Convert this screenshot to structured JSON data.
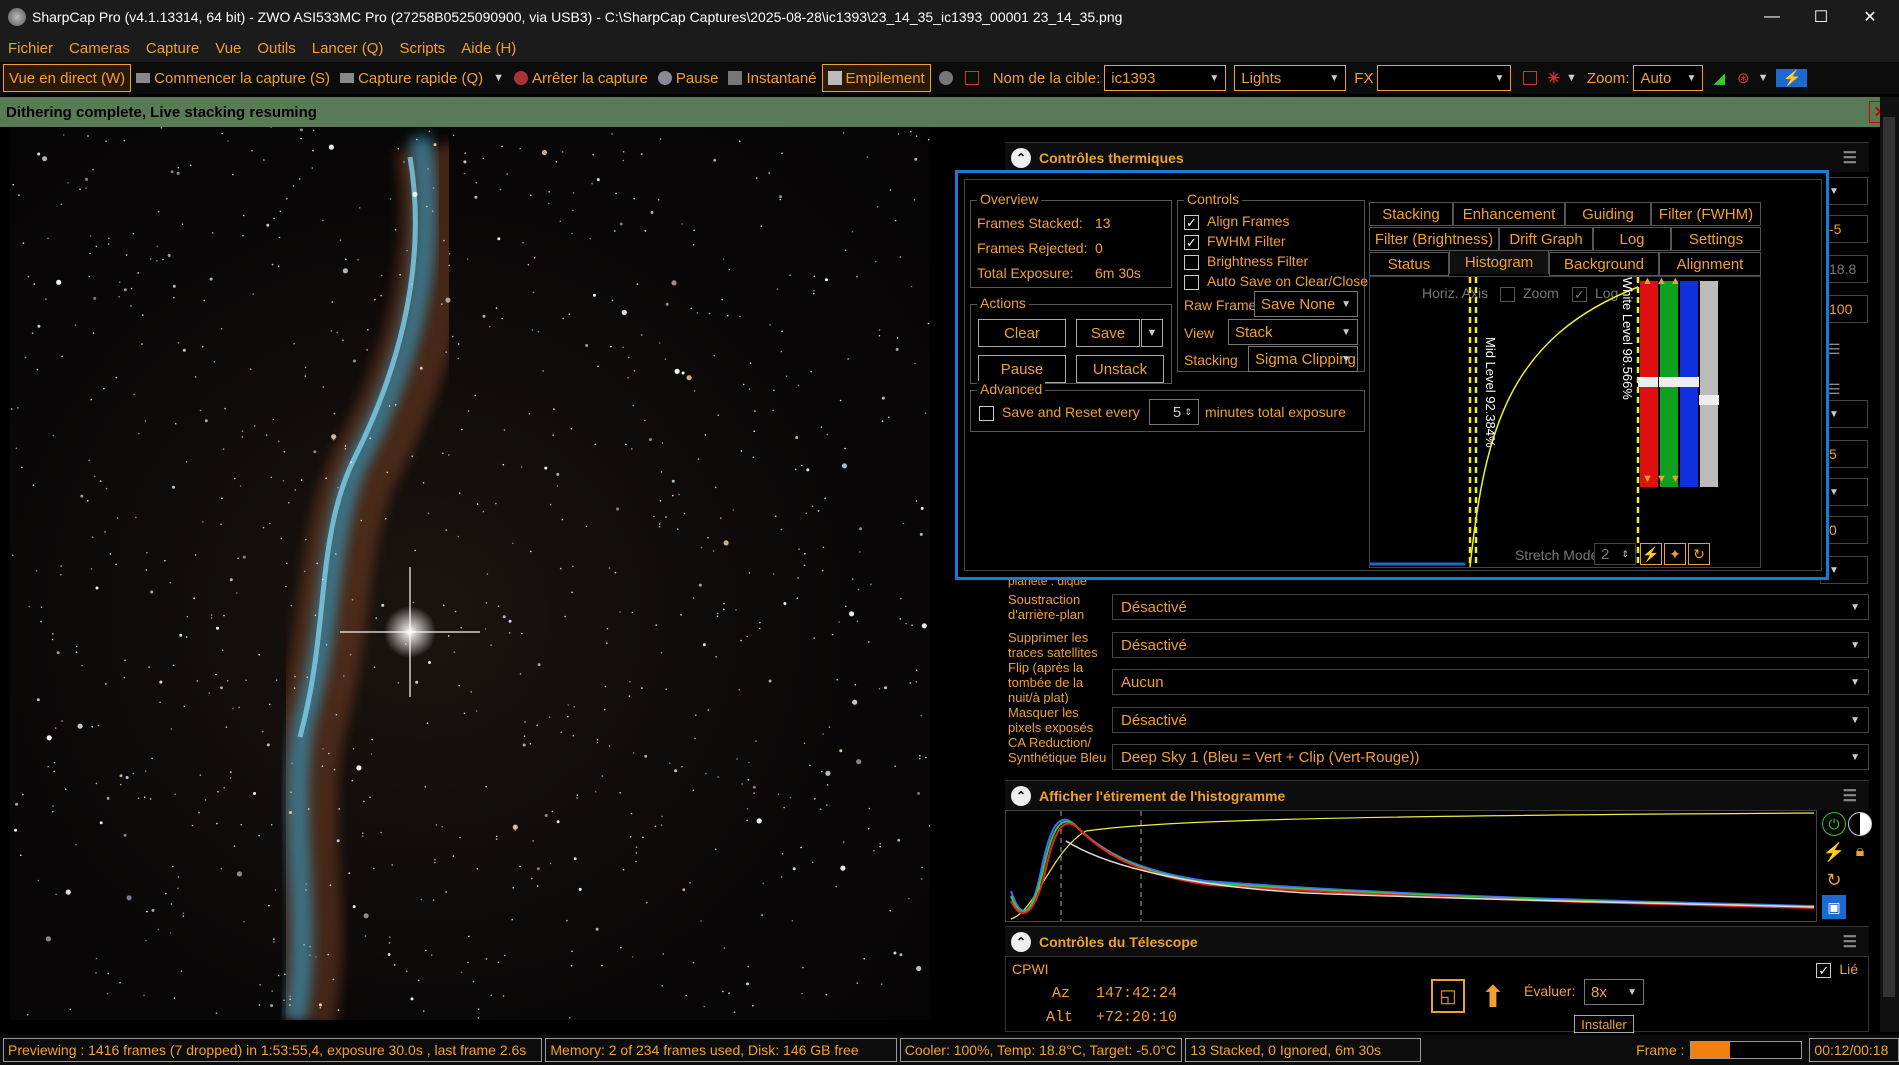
{
  "window": {
    "title": "SharpCap Pro (v4.1.13314, 64 bit) - ZWO ASI533MC Pro (27258B0525090900, via USB3) - C:\\SharpCap Captures\\2025-08-28\\ic1393\\23_14_35_ic1393_00001 23_14_35.png",
    "minimize": "—",
    "maximize": "☐",
    "close": "✕"
  },
  "menu": [
    "Fichier",
    "Cameras",
    "Capture",
    "Vue",
    "Outils",
    "Lancer (Q)",
    "Scripts",
    "Aide (H)"
  ],
  "toolbar": {
    "live_view": "Vue en direct (W)",
    "start_capture": "Commencer la capture (S)",
    "quick_capture": "Capture rapide (Q)",
    "stop_capture": "Arrêter la capture",
    "pause": "Pause",
    "snapshot": "Instantané",
    "stacking": "Empilement",
    "target_label": "Nom de la cible:",
    "target_value": "ic1393",
    "frame_type": "Lights",
    "fx_label": "FX",
    "fx_value": "",
    "zoom_label": "Zoom:",
    "zoom_value": "Auto"
  },
  "notification": {
    "text": "Dithering complete, Live stacking resuming",
    "close": "✕"
  },
  "right_panel": {
    "thermal_header": "Contrôles thermiques",
    "side_values": [
      "-5",
      "18.8",
      "100",
      "5",
      "0"
    ],
    "partial_label": "planète : dique",
    "properties": [
      {
        "label": "Soustraction d'arrière-plan",
        "value": "Désactivé"
      },
      {
        "label": "Supprimer les traces satellites",
        "value": "Désactivé"
      },
      {
        "label": "Flip (après la tombée de la nuit/à plat)",
        "value": "Aucun"
      },
      {
        "label": "Masquer les pixels exposés",
        "value": "Désactivé"
      },
      {
        "label": "CA Reduction/ Synthétique Bleu",
        "value": "Deep Sky 1 (Bleu = Vert + Clip (Vert-Rouge))"
      }
    ],
    "histogram_header": "Afficher l'étirement de l'histogramme",
    "telescope_header": "Contrôles du Télescope",
    "telescope": {
      "name": "CPWI",
      "linked_label": "Lié",
      "az_label": "Az",
      "az_value": "147:42:24",
      "alt_label": "Alt",
      "alt_value": "+72:20:10",
      "rate_label": "Évaluer:",
      "rate_value": "8x",
      "install_label": "Installer"
    }
  },
  "stacking_dialog": {
    "overview": {
      "title": "Overview",
      "frames_stacked_label": "Frames Stacked:",
      "frames_stacked": "13",
      "frames_rejected_label": "Frames Rejected:",
      "frames_rejected": "0",
      "total_exposure_label": "Total Exposure:",
      "total_exposure": "6m 30s"
    },
    "actions": {
      "title": "Actions",
      "clear": "Clear",
      "save": "Save",
      "pause": "Pause",
      "unstack": "Unstack"
    },
    "advanced": {
      "title": "Advanced",
      "save_reset_label": "Save and Reset every",
      "save_reset_value": "5",
      "save_reset_suffix": "minutes total exposure"
    },
    "controls": {
      "title": "Controls",
      "align_frames": "Align Frames",
      "fwhm_filter": "FWHM Filter",
      "brightness_filter": "Brightness Filter",
      "auto_save": "Auto Save on Clear/Close",
      "raw_frames_label": "Raw Frames",
      "raw_frames_value": "Save None",
      "view_label": "View",
      "view_value": "Stack",
      "stacking_label": "Stacking",
      "stacking_value": "Sigma Clipping"
    },
    "tabs_row1": [
      "Stacking",
      "Enhancement",
      "Guiding",
      "Filter (FWHM)"
    ],
    "tabs_row2": [
      "Filter (Brightness)",
      "Drift Graph",
      "Log",
      "Settings"
    ],
    "tabs_row3": [
      "Status",
      "Histogram",
      "Background",
      "Alignment"
    ],
    "histogram": {
      "horiz_axis": "Horiz. Axis",
      "zoom": "Zoom",
      "log": "Log",
      "mid_level": "Mid Level 92.384%",
      "white_level": "White Level 98.566%",
      "stretch_mode_label": "Stretch Mode",
      "stretch_mode_value": "2"
    }
  },
  "statusbar": {
    "preview": "Previewing : 1416 frames (7 dropped) in 1:53:55,4, exposure 30.0s , last frame 2.6s",
    "memory": "Memory: 2 of 234 frames used, Disk: 146 GB free",
    "cooler": "Cooler: 100%, Temp: 18.8°C, Target: -5.0°C",
    "stack": "13 Stacked, 0 Ignored, 6m 30s",
    "frame_label": "Frame :",
    "frame_progress": 0.35,
    "time": "00:12/00:18"
  },
  "colors": {
    "accent": "#f0a030",
    "dialog_border": "#1a7ad9",
    "notify_bg": "#587a55"
  }
}
